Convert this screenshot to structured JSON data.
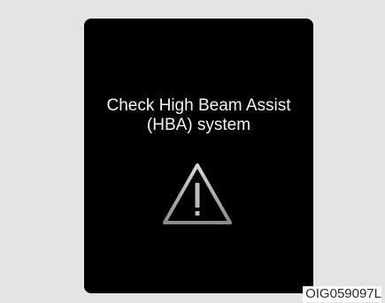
{
  "screen": {
    "message_line1": "Check High Beam Assist",
    "message_line2": "(HBA) system",
    "icon": "warning-triangle-icon"
  },
  "image_code": "OIG059097L",
  "colors": {
    "panel_background": "#e4e4e4",
    "screen_background": "#000000",
    "text": "#f4f4f4",
    "icon_stroke": "#bdbdbd"
  }
}
